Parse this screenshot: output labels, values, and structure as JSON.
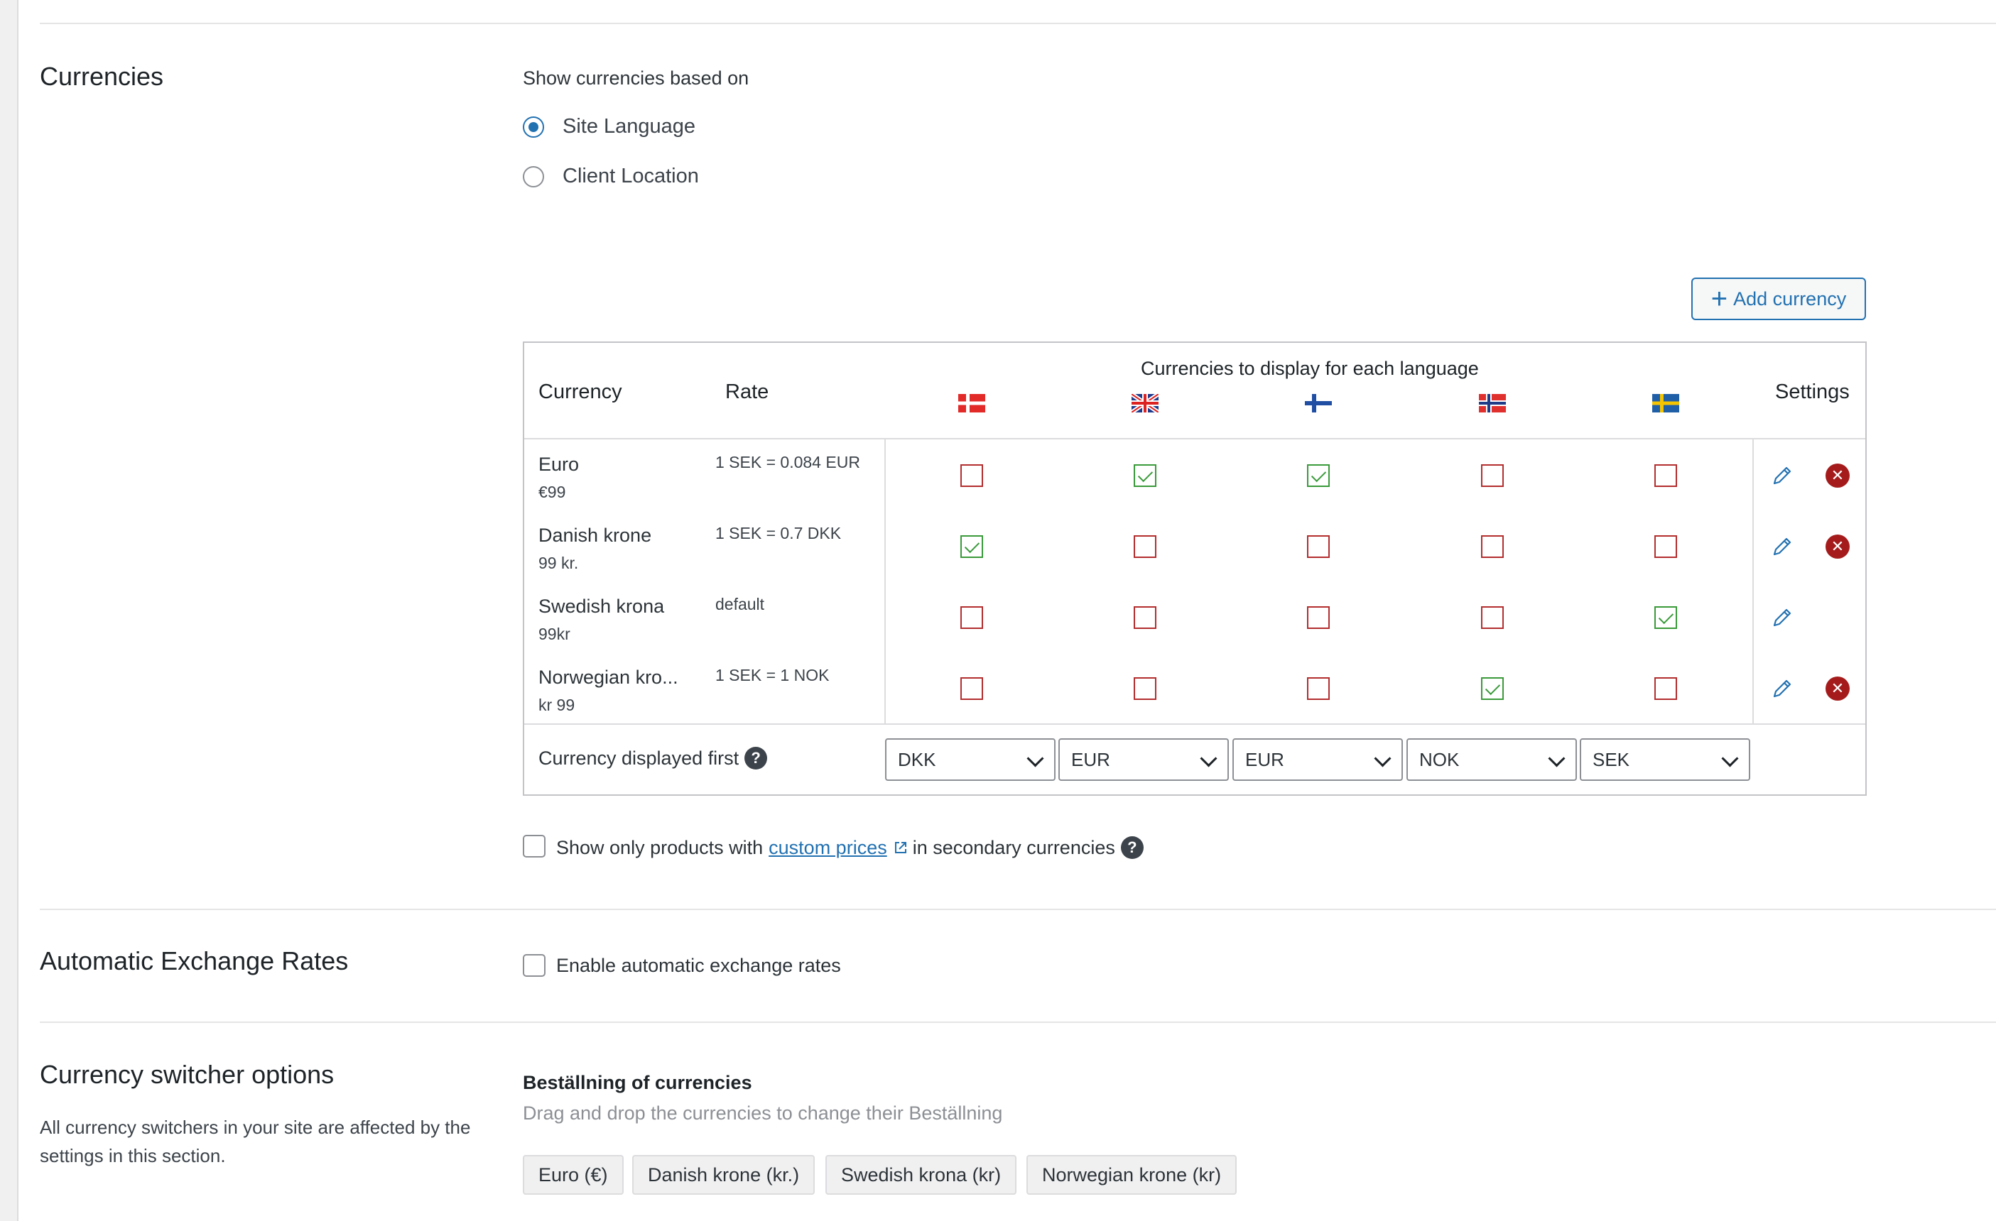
{
  "sections": {
    "currencies": {
      "title": "Currencies",
      "show_based_on_label": "Show currencies based on",
      "radio_site_language": "Site Language",
      "radio_client_location": "Client Location",
      "selected": "Site Language",
      "add_currency_label": "Add currency"
    },
    "exchange": {
      "title": "Automatic Exchange Rates",
      "enable_label": "Enable automatic exchange rates"
    },
    "switcher": {
      "title": "Currency switcher options",
      "description": "All currency switchers in your site are affected by the settings in this section.",
      "order_title": "Beställning of currencies",
      "order_hint": "Drag and drop the currencies to change their Beställning",
      "chips": [
        "Euro (€)",
        "Danish krone (kr.)",
        "Swedish krona (kr)",
        "Norwegian krone (kr)"
      ]
    }
  },
  "table": {
    "col_currency": "Currency",
    "col_rate": "Rate",
    "col_languages": "Currencies to display for each language",
    "col_settings": "Settings",
    "languages": [
      "danish-flag",
      "uk-flag",
      "finnish-flag",
      "norwegian-flag",
      "swedish-flag"
    ],
    "rows": [
      {
        "name": "Euro",
        "symbol": "€99",
        "rate": "1 SEK = 0.084 EUR",
        "checks": [
          false,
          true,
          true,
          false,
          false
        ],
        "deletable": true
      },
      {
        "name": "Danish krone",
        "symbol": "99 kr.",
        "rate": "1 SEK = 0.7 DKK",
        "checks": [
          true,
          false,
          false,
          false,
          false
        ],
        "deletable": true
      },
      {
        "name": "Swedish krona",
        "symbol": "99kr",
        "rate": "default",
        "checks": [
          false,
          false,
          false,
          false,
          true
        ],
        "deletable": false
      },
      {
        "name": "Norwegian kro...",
        "symbol": "kr 99",
        "rate": "1 SEK = 1 NOK",
        "checks": [
          false,
          false,
          false,
          true,
          false
        ],
        "deletable": true
      }
    ],
    "displayed_first_label": "Currency displayed first",
    "displayed_first": [
      "DKK",
      "EUR",
      "EUR",
      "NOK",
      "SEK"
    ]
  },
  "custom_prices": {
    "before": "Show only products with",
    "link": "custom prices",
    "after": "in secondary currencies"
  },
  "colors": {
    "accent": "#2271b1",
    "unchecked_border": "#b32d2e",
    "checked": "#3a9a3a",
    "delete": "#a51b1b"
  }
}
